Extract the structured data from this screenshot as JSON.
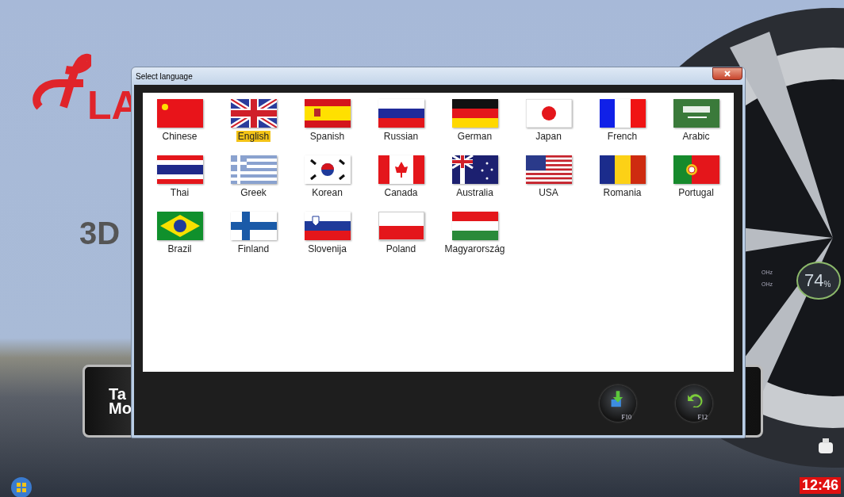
{
  "background": {
    "logo": "LA",
    "heading": "3D",
    "panel_lines": [
      "Ta",
      "Mo"
    ],
    "gauge": {
      "readings": [
        "OHz",
        "OHz"
      ],
      "value": "74",
      "unit": "%"
    }
  },
  "window": {
    "title": "Select language"
  },
  "languages": [
    {
      "label": "Chinese",
      "selected": false
    },
    {
      "label": "English",
      "selected": true
    },
    {
      "label": "Spanish",
      "selected": false
    },
    {
      "label": "Russian",
      "selected": false
    },
    {
      "label": "German",
      "selected": false
    },
    {
      "label": "Japan",
      "selected": false
    },
    {
      "label": "French",
      "selected": false
    },
    {
      "label": "Arabic",
      "selected": false
    },
    {
      "label": "Thai",
      "selected": false
    },
    {
      "label": "Greek",
      "selected": false
    },
    {
      "label": "Korean",
      "selected": false
    },
    {
      "label": "Canada",
      "selected": false
    },
    {
      "label": "Australia",
      "selected": false
    },
    {
      "label": "USA",
      "selected": false
    },
    {
      "label": "Romania",
      "selected": false
    },
    {
      "label": "Portugal",
      "selected": false
    },
    {
      "label": "Brazil",
      "selected": false
    },
    {
      "label": "Finland",
      "selected": false
    },
    {
      "label": "Slovenija",
      "selected": false
    },
    {
      "label": "Poland",
      "selected": false
    },
    {
      "label": "Magyarország",
      "selected": false
    }
  ],
  "buttons": [
    {
      "label": "F10",
      "kind": "confirm"
    },
    {
      "label": "F12",
      "kind": "back"
    }
  ],
  "taskbar": {
    "clock": "12:46"
  }
}
